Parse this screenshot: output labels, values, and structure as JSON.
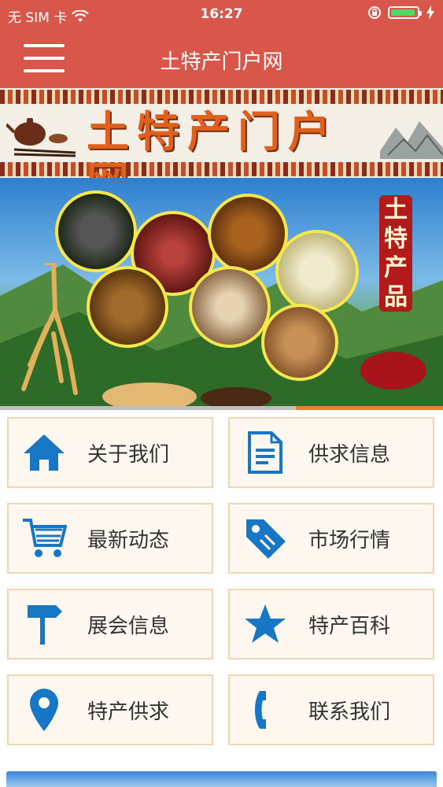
{
  "status_bar": {
    "carrier": "无 SIM 卡",
    "time": "16:27"
  },
  "nav": {
    "title": "土特产门户网"
  },
  "banner": {
    "logo_text": "土特产门户网"
  },
  "hero": {
    "tag_text": [
      "土",
      "特",
      "产",
      "品"
    ]
  },
  "carousel": {
    "progress": 0.33
  },
  "menu": {
    "items": [
      {
        "label": "关于我们",
        "icon": "home-icon"
      },
      {
        "label": "供求信息",
        "icon": "document-icon"
      },
      {
        "label": "最新动态",
        "icon": "cart-icon"
      },
      {
        "label": "市场行情",
        "icon": "tag-icon"
      },
      {
        "label": "展会信息",
        "icon": "signpost-icon"
      },
      {
        "label": "特产百科",
        "icon": "star-icon"
      },
      {
        "label": "特产供求",
        "icon": "location-pin-icon"
      },
      {
        "label": "联系我们",
        "icon": "phone-icon"
      }
    ]
  },
  "colors": {
    "header": "#d9564a",
    "icon_blue": "#1877c4",
    "tile_bg": "#fdf7f0",
    "tile_border": "#f1d6b4"
  }
}
